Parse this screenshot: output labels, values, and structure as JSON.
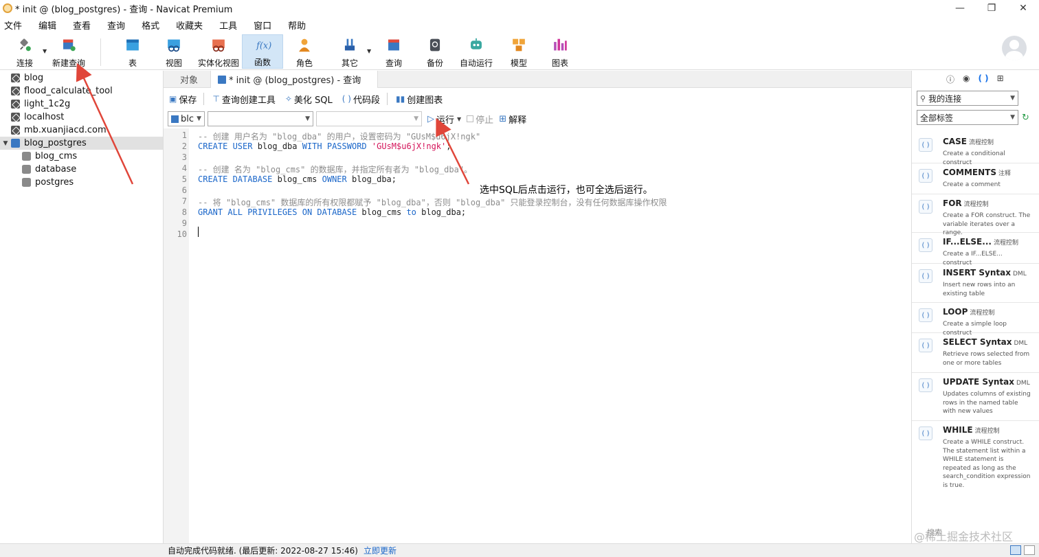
{
  "window": {
    "title": "* init @ (blog_postgres) - 查询 - Navicat Premium",
    "controls": [
      "—",
      "❐",
      "✕"
    ]
  },
  "menu": [
    "文件",
    "编辑",
    "查看",
    "查询",
    "格式",
    "收藏夹",
    "工具",
    "窗口",
    "帮助"
  ],
  "toolbar": {
    "buttons": [
      {
        "label": "连接",
        "icon": "plug-icon"
      },
      {
        "label": "新建查询",
        "icon": "new-query-icon"
      },
      {
        "label": "表",
        "icon": "table-icon"
      },
      {
        "label": "视图",
        "icon": "view-icon"
      },
      {
        "label": "实体化视图",
        "icon": "materialized-view-icon"
      },
      {
        "label": "函数",
        "icon": "function-icon",
        "active": true
      },
      {
        "label": "角色",
        "icon": "role-icon"
      },
      {
        "label": "其它",
        "icon": "others-icon"
      },
      {
        "label": "查询",
        "icon": "query-icon"
      },
      {
        "label": "备份",
        "icon": "backup-icon"
      },
      {
        "label": "自动运行",
        "icon": "robot-icon"
      },
      {
        "label": "模型",
        "icon": "model-icon"
      },
      {
        "label": "图表",
        "icon": "chart-icon"
      }
    ]
  },
  "tree": {
    "items": [
      {
        "label": "blog",
        "type": "connection"
      },
      {
        "label": "flood_calculate_tool",
        "type": "connection"
      },
      {
        "label": "light_1c2g",
        "type": "connection"
      },
      {
        "label": "localhost",
        "type": "connection"
      },
      {
        "label": "mb.xuanjiacd.com",
        "type": "connection"
      },
      {
        "label": "blog_postgres",
        "type": "postgres",
        "expanded": true,
        "selected": true
      },
      {
        "label": "blog_cms",
        "type": "database"
      },
      {
        "label": "database",
        "type": "database"
      },
      {
        "label": "postgres",
        "type": "database"
      }
    ]
  },
  "tabs": {
    "objects": "对象",
    "query": "* init @ (blog_postgres) - 查询"
  },
  "query_toolbar": {
    "save": "保存",
    "builder": "查询创建工具",
    "beautify": "美化 SQL",
    "snippet": "代码段",
    "create_chart": "创建图表"
  },
  "run_bar": {
    "connection_value": "blc",
    "database_value": "",
    "schema_value": "",
    "run": "运行",
    "stop": "停止",
    "explain": "解释"
  },
  "editor": {
    "line_numbers": [
      "1",
      "2",
      "3",
      "4",
      "5",
      "6",
      "7",
      "8",
      "9",
      "10"
    ],
    "annotation": "选中SQL后点击运行，也可全选后运行。"
  },
  "right_panel": {
    "connection_select": "我的连接",
    "tag_select": "全部标签",
    "snippets": [
      {
        "title": "CASE",
        "category": "流程控制",
        "desc": "Create a conditional construct"
      },
      {
        "title": "COMMENTS",
        "category": "注释",
        "desc": "Create a comment"
      },
      {
        "title": "FOR",
        "category": "流程控制",
        "desc": "Create a FOR construct. The variable iterates over a range."
      },
      {
        "title": "IF...ELSE...",
        "category": "流程控制",
        "desc": "Create a IF...ELSE... construct"
      },
      {
        "title": "INSERT Syntax",
        "category": "DML",
        "desc": "Insert new rows into an existing table"
      },
      {
        "title": "LOOP",
        "category": "流程控制",
        "desc": "Create a simple loop construct"
      },
      {
        "title": "SELECT Syntax",
        "category": "DML",
        "desc": "Retrieve rows selected from one or more tables"
      },
      {
        "title": "UPDATE Syntax",
        "category": "DML",
        "desc": "Updates columns of existing rows in the named table with new values"
      },
      {
        "title": "WHILE",
        "category": "流程控制",
        "desc": "Create a WHILE construct. The statement list within a WHILE statement is repeated as long as the search_condition expression is true."
      }
    ],
    "search_placeholder": "搜索"
  },
  "status": {
    "text": "自动完成代码就绪. (最后更新: 2022-08-27 15:46)",
    "link": "立即更新"
  },
  "watermark": "@稀土掘金技术社区",
  "colors": {
    "keyword": "#1a66c9",
    "comment": "#8c8c8c",
    "string": "#d4145a",
    "arrow": "#e0463a",
    "active_button": "#d3e6f7"
  }
}
